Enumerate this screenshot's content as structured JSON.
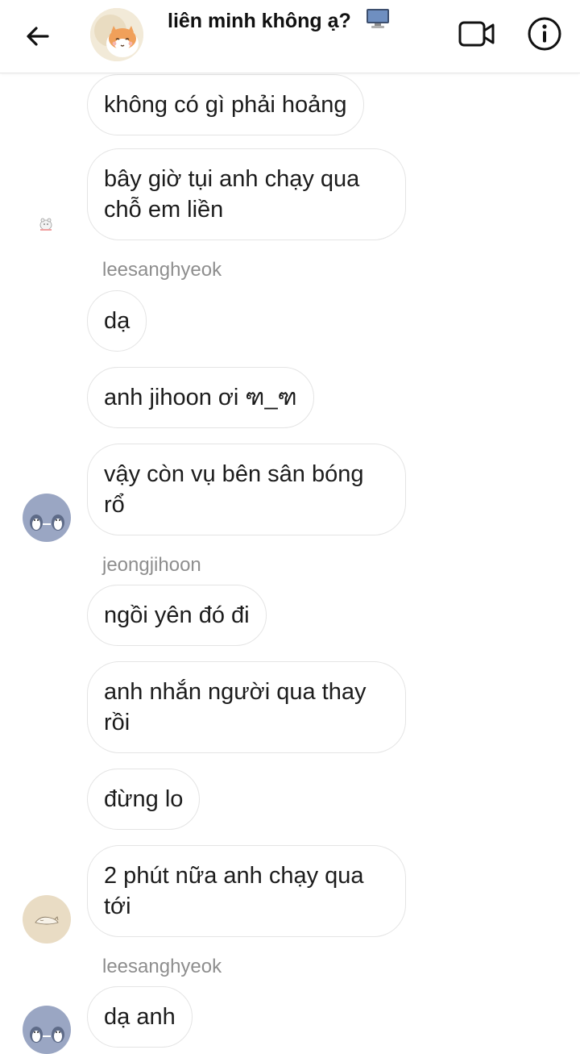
{
  "header": {
    "title": "liên minh không ạ?",
    "title_emoji": "computer-monitor-icon",
    "back_icon": "arrow-left-icon",
    "video_icon": "video-camera-icon",
    "info_icon": "info-circle-icon"
  },
  "messages": [
    {
      "text": "không có gì phải hoảng"
    },
    {
      "text": "bây giờ tụi anh chạy qua chỗ em liền"
    },
    {
      "sender": "leesanghyeok"
    },
    {
      "text": "dạ"
    },
    {
      "text": "anh jihoon ơi ฑ_ฑ"
    },
    {
      "text": "vậy còn vụ bên sân bóng rổ"
    },
    {
      "sender": "jeongjihoon"
    },
    {
      "text": "ngồi yên đó đi"
    },
    {
      "text": "anh nhắn người qua thay rồi"
    },
    {
      "text": "đừng lo"
    },
    {
      "text": "2 phút nữa anh chạy qua tới"
    },
    {
      "sender": "leesanghyeok"
    },
    {
      "text": "dạ anh"
    }
  ],
  "colors": {
    "bubble_border": "#e4e4e4",
    "sender_text": "#8e8e8e",
    "avatar_penguin_bg": "#9aa6c3",
    "avatar_beige_bg": "#e9dcc4"
  }
}
